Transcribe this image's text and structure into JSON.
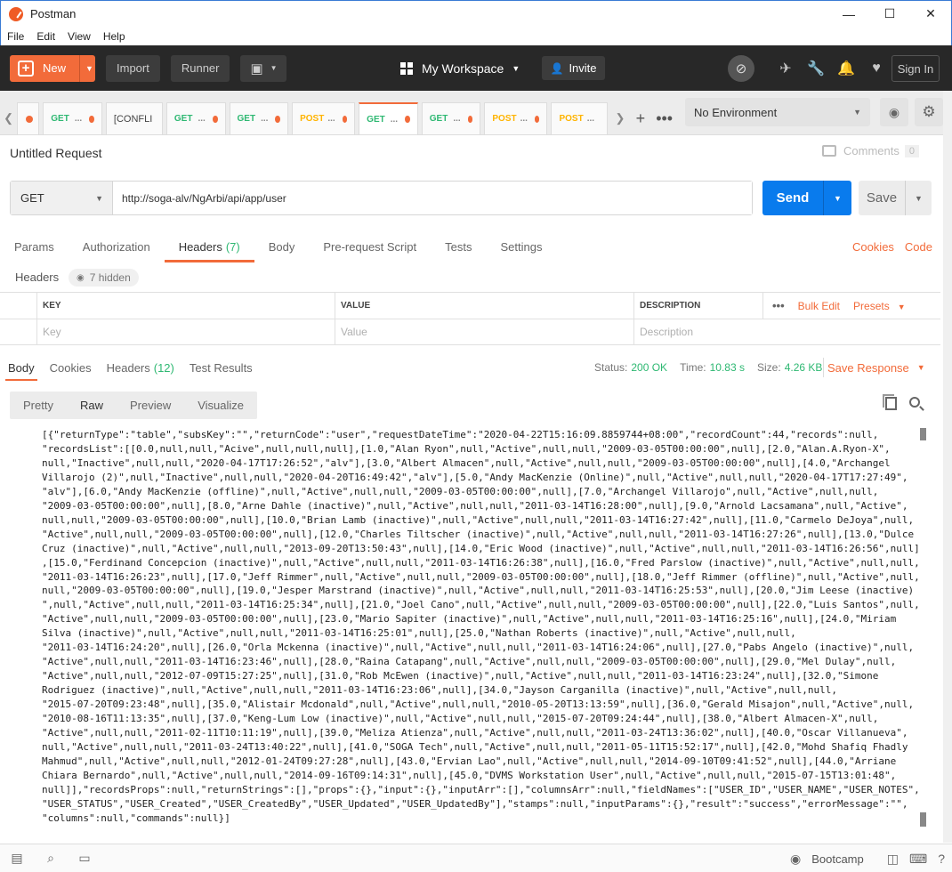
{
  "window": {
    "title": "Postman",
    "minimize": "—",
    "maximize": "☐",
    "close": "✕"
  },
  "menu": [
    "File",
    "Edit",
    "View",
    "Help"
  ],
  "header": {
    "new_label": "New",
    "import_label": "Import",
    "runner_label": "Runner",
    "workspace_label": "My Workspace",
    "invite_label": "Invite",
    "signin_label": "Sign In"
  },
  "tabs": [
    {
      "method": "GET",
      "dot": true
    },
    {
      "method": "[CONFLI",
      "dot": false
    },
    {
      "method": "GET",
      "dot": true
    },
    {
      "method": "GET",
      "dot": true
    },
    {
      "method": "POST",
      "dot": true
    },
    {
      "method": "GET",
      "dot": true,
      "active": true
    },
    {
      "method": "GET",
      "dot": true
    },
    {
      "method": "POST",
      "dot": true
    },
    {
      "method": "POST",
      "dot": true
    }
  ],
  "environment": {
    "selected": "No Environment"
  },
  "request": {
    "title": "Untitled Request",
    "comments_label": "Comments",
    "comments_count": "0",
    "method": "GET",
    "url": "http://soga-alv/NgArbi/api/app/user",
    "send_label": "Send",
    "save_label": "Save"
  },
  "request_tabs": {
    "params": "Params",
    "authorization": "Authorization",
    "headers": "Headers",
    "headers_count": "(7)",
    "body": "Body",
    "prerequest": "Pre-request Script",
    "tests": "Tests",
    "settings": "Settings",
    "cookies": "Cookies",
    "code": "Code"
  },
  "headers_section": {
    "label": "Headers",
    "hidden": "7 hidden",
    "col_key": "KEY",
    "col_value": "VALUE",
    "col_description": "DESCRIPTION",
    "bulk_edit": "Bulk Edit",
    "presets": "Presets",
    "key_placeholder": "Key",
    "value_placeholder": "Value",
    "description_placeholder": "Description"
  },
  "response": {
    "tab_body": "Body",
    "tab_cookies": "Cookies",
    "tab_headers": "Headers",
    "headers_count": "(12)",
    "tab_test_results": "Test Results",
    "status_label": "Status:",
    "status_value": "200 OK",
    "time_label": "Time:",
    "time_value": "10.83 s",
    "size_label": "Size:",
    "size_value": "4.26 KB",
    "save_response": "Save Response",
    "view_modes": [
      "Pretty",
      "Raw",
      "Preview",
      "Visualize"
    ],
    "active_view": "Raw",
    "body_text": "[{\"returnType\":\"table\",\"subsKey\":\"\",\"returnCode\":\"user\",\"requestDateTime\":\"2020-04-22T15:16:09.8859744+08:00\",\"recordCount\":44,\"records\":null,\n\"recordsList\":[[0.0,null,null,\"Acive\",null,null,null],[1.0,\"Alan Ryon\",null,\"Active\",null,null,\"2009-03-05T00:00:00\",null],[2.0,\"Alan.A.Ryon-X\",\nnull,\"Inactive\",null,null,\"2020-04-17T17:26:52\",\"alv\"],[3.0,\"Albert Almacen\",null,\"Active\",null,null,\"2009-03-05T00:00:00\",null],[4.0,\"Archangel\nVillarojo (2)\",null,\"Inactive\",null,null,\"2020-04-20T16:49:42\",\"alv\"],[5.0,\"Andy MacKenzie (Online)\",null,\"Active\",null,null,\"2020-04-17T17:27:49\",\n\"alv\"],[6.0,\"Andy MacKenzie (offline)\",null,\"Active\",null,null,\"2009-03-05T00:00:00\",null],[7.0,\"Archangel Villarojo\",null,\"Active\",null,null,\n\"2009-03-05T00:00:00\",null],[8.0,\"Arne Dahle (inactive)\",null,\"Active\",null,null,\"2011-03-14T16:28:00\",null],[9.0,\"Arnold Lacsamana\",null,\"Active\",\nnull,null,\"2009-03-05T00:00:00\",null],[10.0,\"Brian Lamb (inactive)\",null,\"Active\",null,null,\"2011-03-14T16:27:42\",null],[11.0,\"Carmelo DeJoya\",null,\n\"Active\",null,null,\"2009-03-05T00:00:00\",null],[12.0,\"Charles Tiltscher (inactive)\",null,\"Active\",null,null,\"2011-03-14T16:27:26\",null],[13.0,\"Dulce\nCruz (inactive)\",null,\"Active\",null,null,\"2013-09-20T13:50:43\",null],[14.0,\"Eric Wood (inactive)\",null,\"Active\",null,null,\"2011-03-14T16:26:56\",null]\n,[15.0,\"Ferdinand Concepcion (inactive)\",null,\"Active\",null,null,\"2011-03-14T16:26:38\",null],[16.0,\"Fred Parslow (inactive)\",null,\"Active\",null,null,\n\"2011-03-14T16:26:23\",null],[17.0,\"Jeff Rimmer\",null,\"Active\",null,null,\"2009-03-05T00:00:00\",null],[18.0,\"Jeff Rimmer (offline)\",null,\"Active\",null,\nnull,\"2009-03-05T00:00:00\",null],[19.0,\"Jesper Marstrand (inactive)\",null,\"Active\",null,null,\"2011-03-14T16:25:53\",null],[20.0,\"Jim Leese (inactive)\n\",null,\"Active\",null,null,\"2011-03-14T16:25:34\",null],[21.0,\"Joel Cano\",null,\"Active\",null,null,\"2009-03-05T00:00:00\",null],[22.0,\"Luis Santos\",null,\n\"Active\",null,null,\"2009-03-05T00:00:00\",null],[23.0,\"Mario Sapiter (inactive)\",null,\"Active\",null,null,\"2011-03-14T16:25:16\",null],[24.0,\"Miriam\nSilva (inactive)\",null,\"Active\",null,null,\"2011-03-14T16:25:01\",null],[25.0,\"Nathan Roberts (inactive)\",null,\"Active\",null,null,\n\"2011-03-14T16:24:20\",null],[26.0,\"Orla Mckenna (inactive)\",null,\"Active\",null,null,\"2011-03-14T16:24:06\",null],[27.0,\"Pabs Angelo (inactive)\",null,\n\"Active\",null,null,\"2011-03-14T16:23:46\",null],[28.0,\"Raina Catapang\",null,\"Active\",null,null,\"2009-03-05T00:00:00\",null],[29.0,\"Mel Dulay\",null,\n\"Active\",null,null,\"2012-07-09T15:27:25\",null],[31.0,\"Rob McEwen (inactive)\",null,\"Active\",null,null,\"2011-03-14T16:23:24\",null],[32.0,\"Simone\nRodriguez (inactive)\",null,\"Active\",null,null,\"2011-03-14T16:23:06\",null],[34.0,\"Jayson Carganilla (inactive)\",null,\"Active\",null,null,\n\"2015-07-20T09:23:48\",null],[35.0,\"Alistair Mcdonald\",null,\"Active\",null,null,\"2010-05-20T13:13:59\",null],[36.0,\"Gerald Misajon\",null,\"Active\",null,\n\"2010-08-16T11:13:35\",null],[37.0,\"Keng-Lum Low (inactive)\",null,\"Active\",null,null,\"2015-07-20T09:24:44\",null],[38.0,\"Albert Almacen-X\",null,\n\"Active\",null,null,\"2011-02-11T10:11:19\",null],[39.0,\"Meliza Atienza\",null,\"Active\",null,null,\"2011-03-24T13:36:02\",null],[40.0,\"Oscar Villanueva\",\nnull,\"Active\",null,null,\"2011-03-24T13:40:22\",null],[41.0,\"SOGA Tech\",null,\"Active\",null,null,\"2011-05-11T15:52:17\",null],[42.0,\"Mohd Shafiq Fhadly\nMahmud\",null,\"Active\",null,null,\"2012-01-24T09:27:28\",null],[43.0,\"Ervian Lao\",null,\"Active\",null,null,\"2014-09-10T09:41:52\",null],[44.0,\"Arriane\nChiara Bernardo\",null,\"Active\",null,null,\"2014-09-16T09:14:31\",null],[45.0,\"DVMS Workstation User\",null,\"Active\",null,null,\"2015-07-15T13:01:48\",\nnull]],\"recordsProps\":null,\"returnStrings\":[],\"props\":{},\"input\":{},\"inputArr\":[],\"columnsArr\":null,\"fieldNames\":[\"USER_ID\",\"USER_NAME\",\"USER_NOTES\",\n\"USER_STATUS\",\"USER_Created\",\"USER_CreatedBy\",\"USER_Updated\",\"USER_UpdatedBy\"],\"stamps\":null,\"inputParams\":{},\"result\":\"success\",\"errorMessage\":\"\",\n\"columns\":null,\"commands\":null}]"
  },
  "statusbar": {
    "bootcamp": "Bootcamp"
  },
  "icons": {
    "new": "plus-icon",
    "capture": "capture-icon",
    "sync": "sync-off-icon",
    "satellite": "satellite-icon",
    "wrench": "wrench-icon",
    "bell": "bell-icon",
    "heart": "heart-icon"
  }
}
